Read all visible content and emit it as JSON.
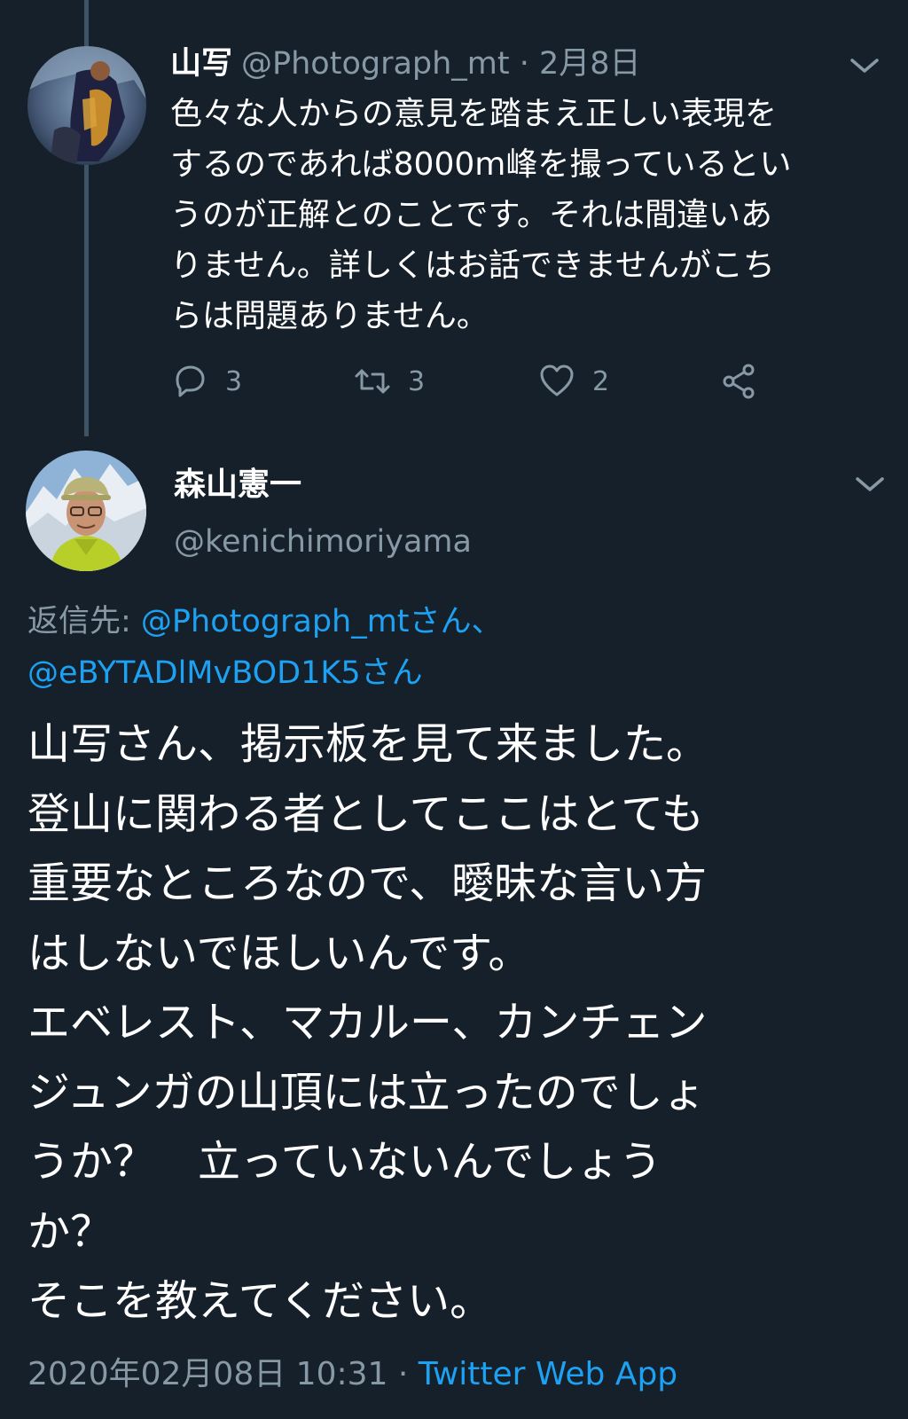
{
  "colors": {
    "background": "#15202b",
    "secondary_text": "#8899a6",
    "link": "#1da1f2",
    "thread_line": "#3d5466"
  },
  "tweet1": {
    "display_name": "山写",
    "meta": "@Photograph_mt · 2月8日",
    "menu_icon": "chevron-down-icon",
    "body_lines": [
      "色々な人からの意見を踏まえ正しい表現を",
      "するのであれば8000m峰を撮っているとい",
      "うのが正解とのことです。それは間違いあ",
      "りません。詳しくはお話できませんがこち",
      "らは問題ありません。"
    ],
    "actions": {
      "reply_count": "3",
      "retweet_count": "3",
      "like_count": "2",
      "reply_icon": "reply-icon",
      "retweet_icon": "retweet-icon",
      "like_icon": "heart-icon",
      "share_icon": "share-icon"
    }
  },
  "tweet2": {
    "display_name": "森山憲一",
    "handle": "@kenichimoriyama",
    "menu_icon": "chevron-down-icon",
    "replying_to": {
      "prefix": "返信先: ",
      "mention1": "@Photograph_mtさん、",
      "mention2": "@eBYTADlMvBOD1K5さん"
    },
    "body_lines": [
      "山写さん、掲示板を見て来ました。",
      "登山に関わる者としてここはとても",
      "重要なところなので、曖昧な言い方",
      "はしないでほしいんです。",
      "エベレスト、マカルー、カンチェン",
      "ジュンガの山頂には立ったのでしょ",
      "うか？　立っていないんでしょう",
      "か？",
      "そこを教えてください。"
    ],
    "timestamp": "2020年02月08日 10:31",
    "separator": " · ",
    "source": "Twitter Web App"
  }
}
